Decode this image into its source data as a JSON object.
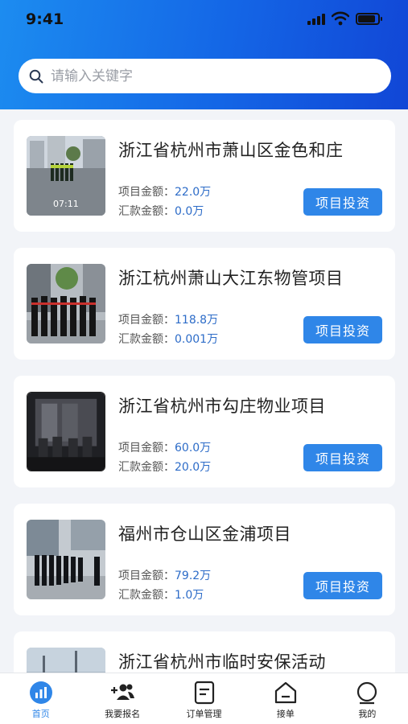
{
  "status_bar": {
    "time": "9:41"
  },
  "search": {
    "placeholder": "请输入关键字"
  },
  "labels": {
    "project_amount": "项目金额：",
    "remit_amount": "汇款金额：",
    "invest_button": "项目投资"
  },
  "projects": [
    {
      "title": "浙江省杭州市萧山区金色和庄",
      "amount": "22.0万",
      "remit": "0.0万",
      "thumb_timestamp": "07:11"
    },
    {
      "title": "浙江杭州萧山大江东物管项目",
      "amount": "118.8万",
      "remit": "0.001万"
    },
    {
      "title": "浙江省杭州市勾庄物业项目",
      "amount": "60.0万",
      "remit": "20.0万"
    },
    {
      "title": "福州市仓山区金浦项目",
      "amount": "79.2万",
      "remit": "1.0万"
    },
    {
      "title": "浙江省杭州市临时安保活动"
    }
  ],
  "tabs": [
    {
      "label": "首页",
      "icon": "home-chart-icon",
      "active": true
    },
    {
      "label": "我要报名",
      "icon": "add-user-icon"
    },
    {
      "label": "订单管理",
      "icon": "document-icon"
    },
    {
      "label": "接单",
      "icon": "home-icon"
    },
    {
      "label": "我的",
      "icon": "user-icon"
    }
  ],
  "colors": {
    "header_start": "#1c8cf0",
    "header_end": "#1146d6",
    "accent": "#2f86e8",
    "value_text": "#2d6cc8"
  }
}
